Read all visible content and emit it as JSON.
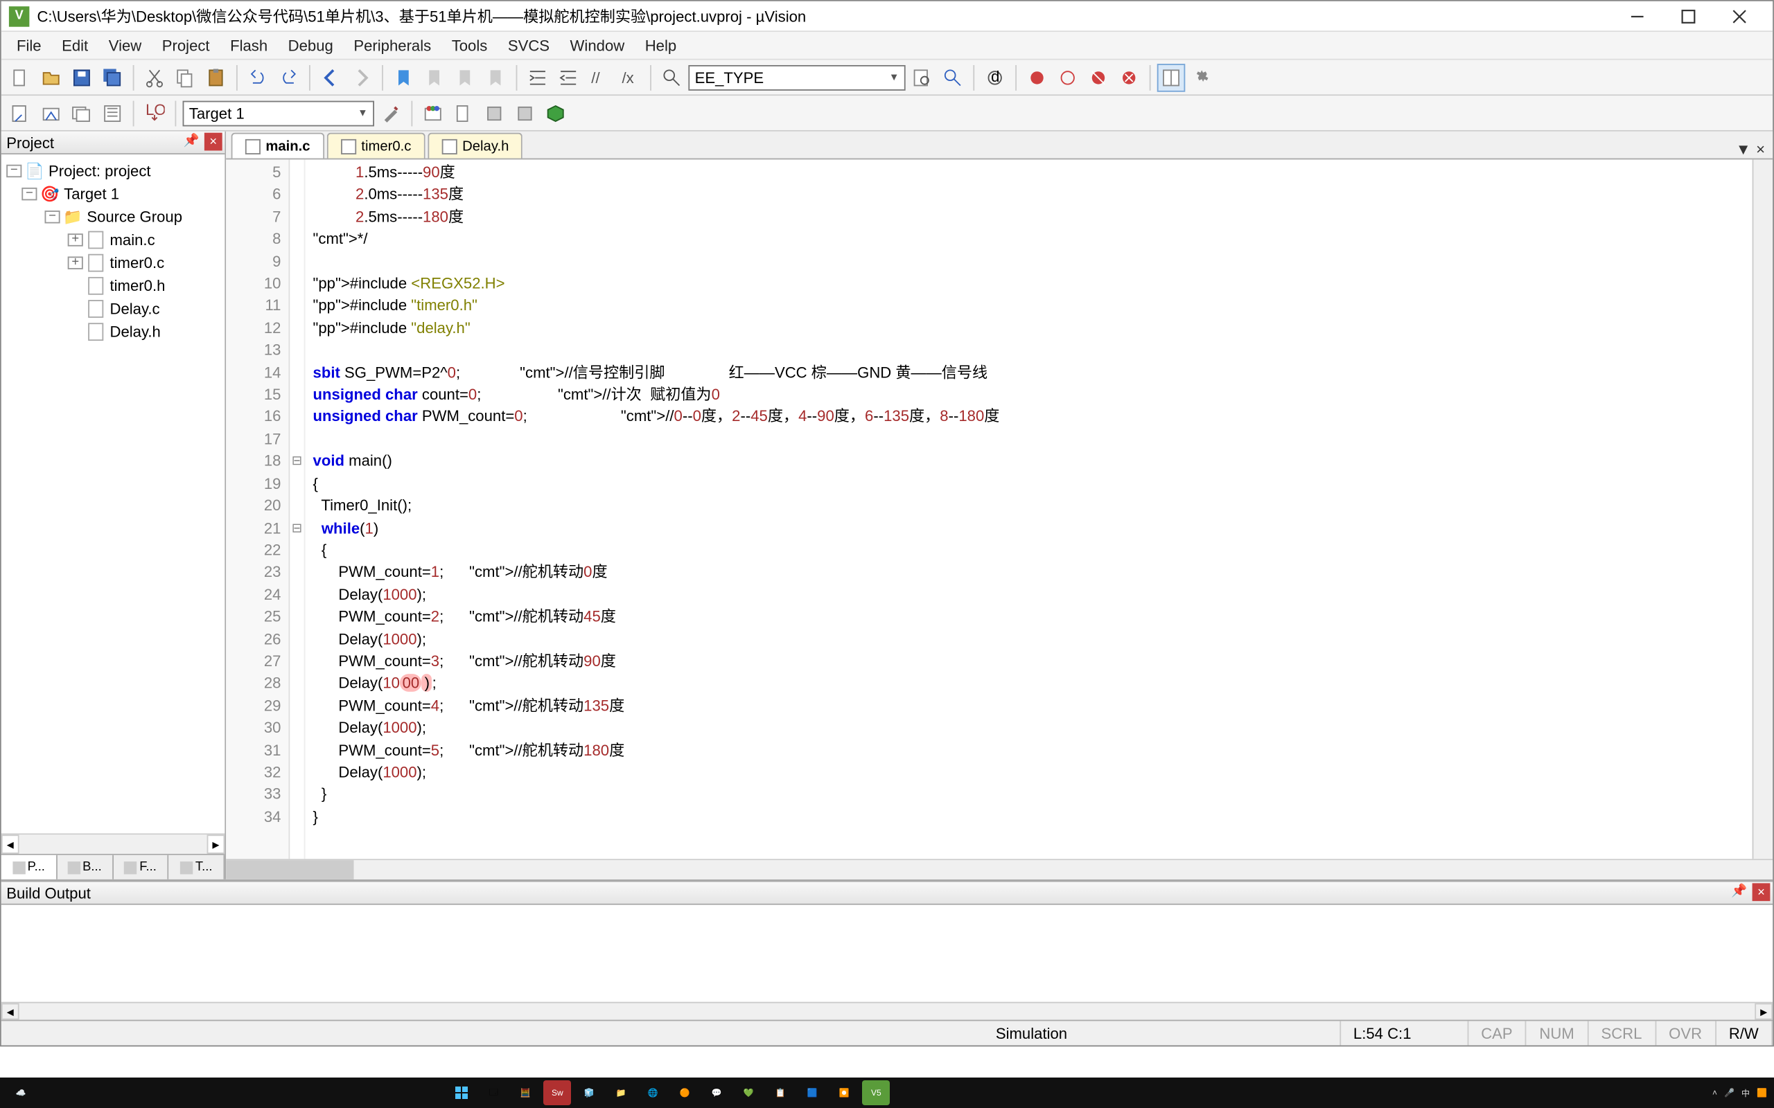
{
  "window": {
    "title": "C:\\Users\\华为\\Desktop\\微信公众号代码\\51单片机\\3、基于51单片机——模拟舵机控制实验\\project.uvproj - µVision"
  },
  "menu": [
    "File",
    "Edit",
    "View",
    "Project",
    "Flash",
    "Debug",
    "Peripherals",
    "Tools",
    "SVCS",
    "Window",
    "Help"
  ],
  "toolbar2": {
    "target": "Target 1",
    "search": "EE_TYPE"
  },
  "project_panel": {
    "title": "Project",
    "tree": {
      "root": "Project: project",
      "target": "Target 1",
      "group": "Source Group",
      "files": [
        "main.c",
        "timer0.c",
        "timer0.h",
        "Delay.c",
        "Delay.h"
      ]
    },
    "tabs": [
      "P...",
      "B...",
      "F...",
      "T..."
    ]
  },
  "editor": {
    "tabs": [
      {
        "label": "main.c",
        "active": true
      },
      {
        "label": "timer0.c",
        "active": false
      },
      {
        "label": "Delay.h",
        "active": false
      }
    ],
    "first_line_no": 5,
    "fold_marks": {
      "19": "⊟",
      "22": "⊟"
    }
  },
  "code_lines": [
    "          1.5ms-----90度",
    "          2.0ms-----135度",
    "          2.5ms-----180度",
    "*/",
    "",
    "#include <REGX52.H>",
    "#include \"timer0.h\"",
    "#include \"delay.h\"",
    "",
    "sbit SG_PWM=P2^0;              //信号控制引脚               红——VCC 棕——GND 黄——信号线",
    "unsigned char count=0;                  //计次  赋初值为0",
    "unsigned char PWM_count=0;                      //0--0度，2--45度，4--90度，6--135度，8--180度",
    "",
    "void main()",
    "{",
    "  Timer0_Init();",
    "  while(1)",
    "  {",
    "      PWM_count=1;      //舵机转动0度",
    "      Delay(1000);",
    "      PWM_count=2;      //舵机转动45度",
    "      Delay(1000);",
    "      PWM_count=3;      //舵机转动90度",
    "      Delay(1000);",
    "      PWM_count=4;      //舵机转动135度",
    "      Delay(1000);",
    "      PWM_count=5;      //舵机转动180度",
    "      Delay(1000);",
    "  }",
    "}"
  ],
  "highlight_line_index": 23,
  "build_output": {
    "title": "Build Output"
  },
  "status": {
    "mode": "Simulation",
    "pos": "L:54 C:1",
    "flags": [
      "CAP",
      "NUM",
      "SCRL",
      "OVR",
      "R/W"
    ]
  }
}
